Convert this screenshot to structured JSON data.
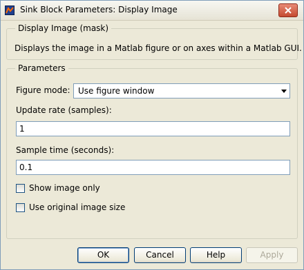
{
  "window": {
    "title": "Sink Block Parameters: Display Image",
    "icons": {
      "app": "matlab-block-icon",
      "close": "close-x-icon"
    }
  },
  "mask_group": {
    "legend": "Display Image (mask)",
    "description": "Displays the image in a Matlab figure or on axes within a Matlab GUI."
  },
  "parameters": {
    "legend": "Parameters",
    "figure_mode": {
      "label": "Figure mode:",
      "selected": "Use figure window"
    },
    "update_rate": {
      "label": "Update rate (samples):",
      "value": "1"
    },
    "sample_time": {
      "label": "Sample time (seconds):",
      "value": "0.1"
    },
    "show_image_only": {
      "label": "Show image only",
      "checked": false
    },
    "use_original_size": {
      "label": "Use original image size",
      "checked": false
    }
  },
  "buttons": {
    "ok": "OK",
    "cancel": "Cancel",
    "help": "Help",
    "apply": "Apply"
  }
}
